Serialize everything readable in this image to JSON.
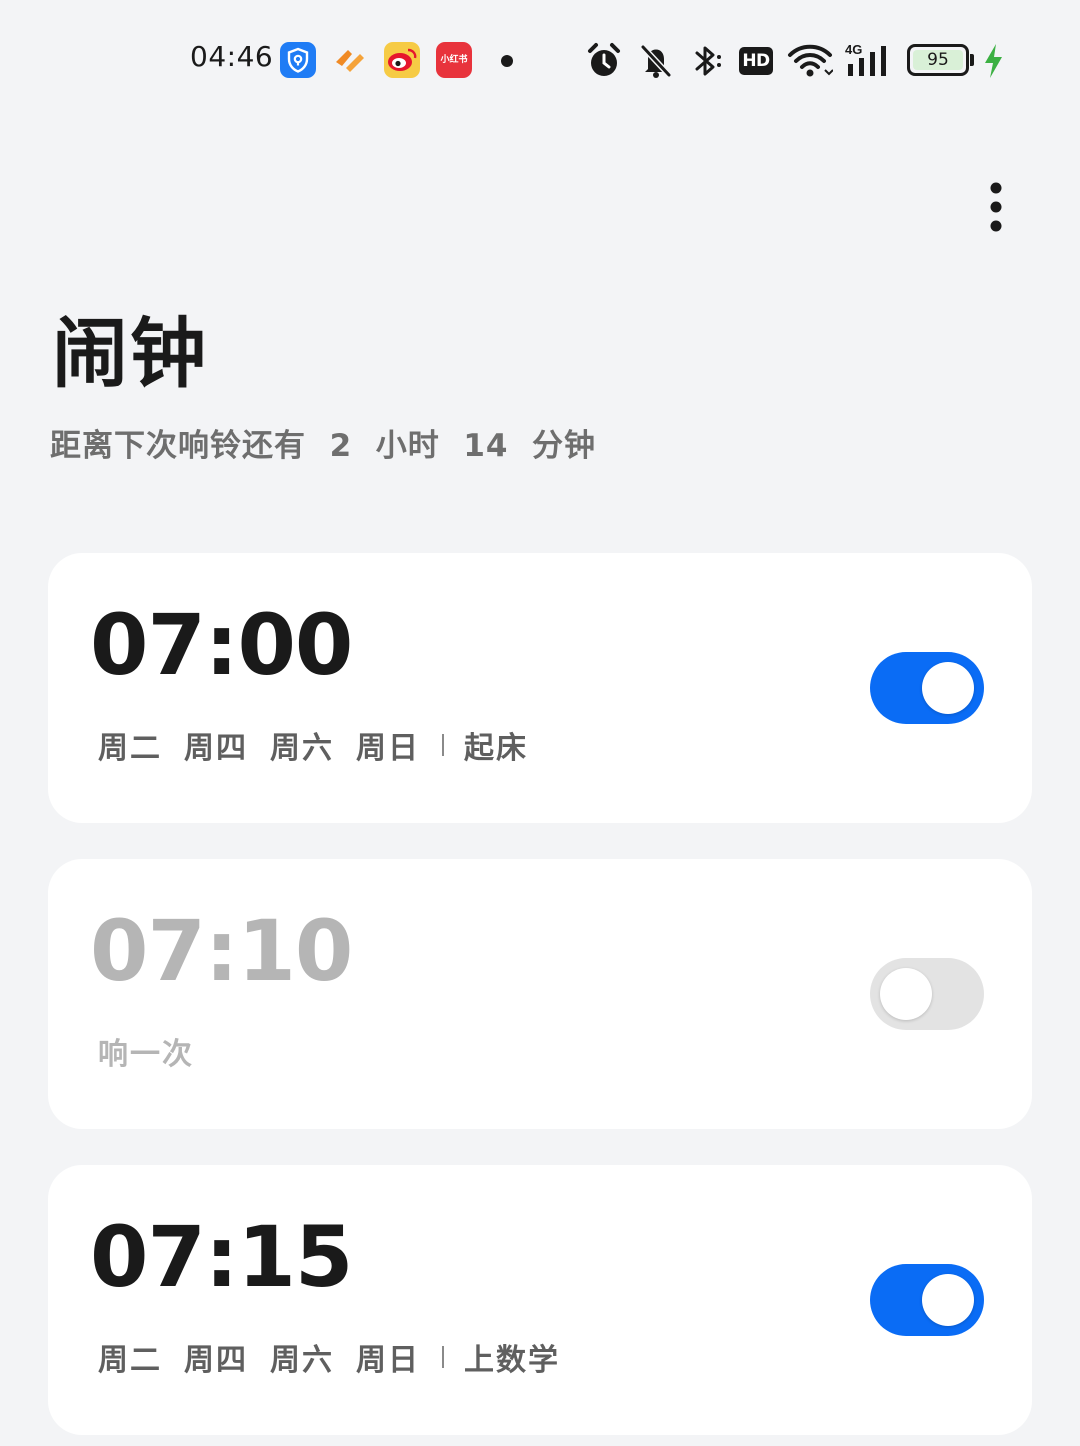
{
  "status_bar": {
    "time": "04:46",
    "notification_icons": [
      "security-shield-icon",
      "health-app-icon",
      "weibo-icon",
      "xiaohongshu-icon"
    ],
    "xiaohongshu_label": "小红书",
    "system_icons": [
      "alarm-icon",
      "bell-muted-icon",
      "bluetooth-icon",
      "hd-icon",
      "wifi-icon",
      "signal-4g-icon",
      "battery-icon",
      "charging-icon"
    ],
    "hd_label": "HD",
    "network_label": "4G",
    "battery_level": "95",
    "charging": true,
    "colors": {
      "charging": "#3cb043",
      "shield": "#1f7cf5",
      "weibo": "#f6cb45",
      "xiaohongshu": "#e8333c"
    }
  },
  "header": {
    "title": "闹钟",
    "subtitle": "距离下次响铃还有  2  小时  14  分钟"
  },
  "alarms": [
    {
      "time": "07:00",
      "enabled": true,
      "days": [
        "周二",
        "周四",
        "周六",
        "周日"
      ],
      "label": "起床"
    },
    {
      "time": "07:10",
      "enabled": false,
      "repeat": "响一次"
    },
    {
      "time": "07:15",
      "enabled": true,
      "days": [
        "周二",
        "周四",
        "周六",
        "周日"
      ],
      "label": "上数学"
    }
  ],
  "colors": {
    "accent": "#0a6cf5",
    "background": "#f3f4f6",
    "card": "#ffffff",
    "disabled_text": "#b5b5b5",
    "toggle_off": "#e3e3e3"
  }
}
